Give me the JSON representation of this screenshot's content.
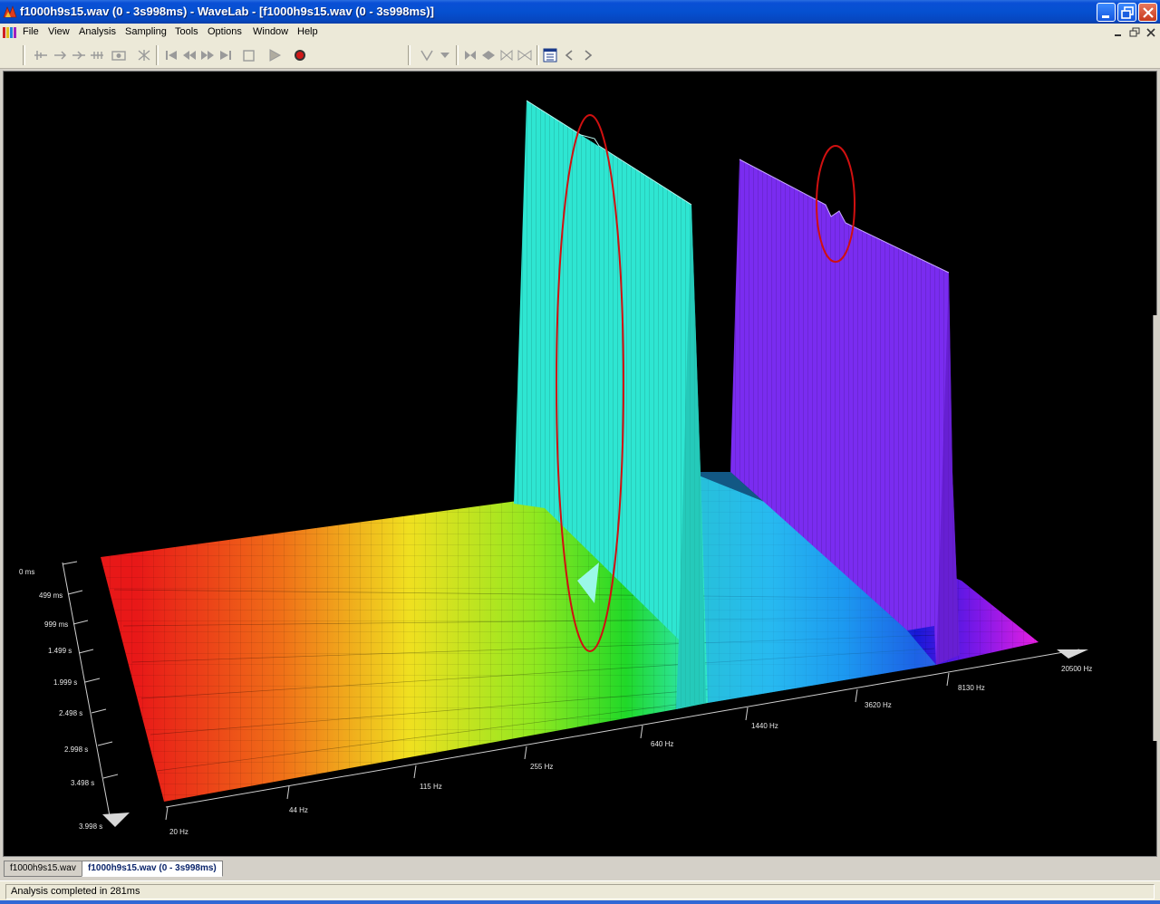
{
  "window": {
    "title": "f1000h9s15.wav (0 - 3s998ms) - WaveLab - [f1000h9s15.wav (0 - 3s998ms)]"
  },
  "menu": [
    "File",
    "View",
    "Analysis",
    "Sampling",
    "Tools",
    "Options",
    "Window",
    "Help"
  ],
  "plot": {
    "freq_labels": [
      "20 Hz",
      "44 Hz",
      "115 Hz",
      "255 Hz",
      "640 Hz",
      "1440 Hz",
      "3620 Hz",
      "8130 Hz",
      "20500 Hz"
    ],
    "time_labels": [
      "0 ms",
      "499 ms",
      "999 ms",
      "1.499 s",
      "1.999 s",
      "2.498 s",
      "2.998 s",
      "3.498 s",
      "3.998 s"
    ],
    "peaks": [
      {
        "frequency_label": "1000 Hz",
        "color": "#2ee6d2"
      },
      {
        "frequency_label": "9000 Hz",
        "color": "#7a2cf0"
      }
    ],
    "annotation_color": "#d01010"
  },
  "tabs": [
    "f1000h9s15.wav",
    "f1000h9s15.wav (0 - 3s998ms)"
  ],
  "status": "Analysis completed in 281ms",
  "colors": {
    "titlebar": "#0550d0",
    "active_tab_text": "#0a246a"
  }
}
